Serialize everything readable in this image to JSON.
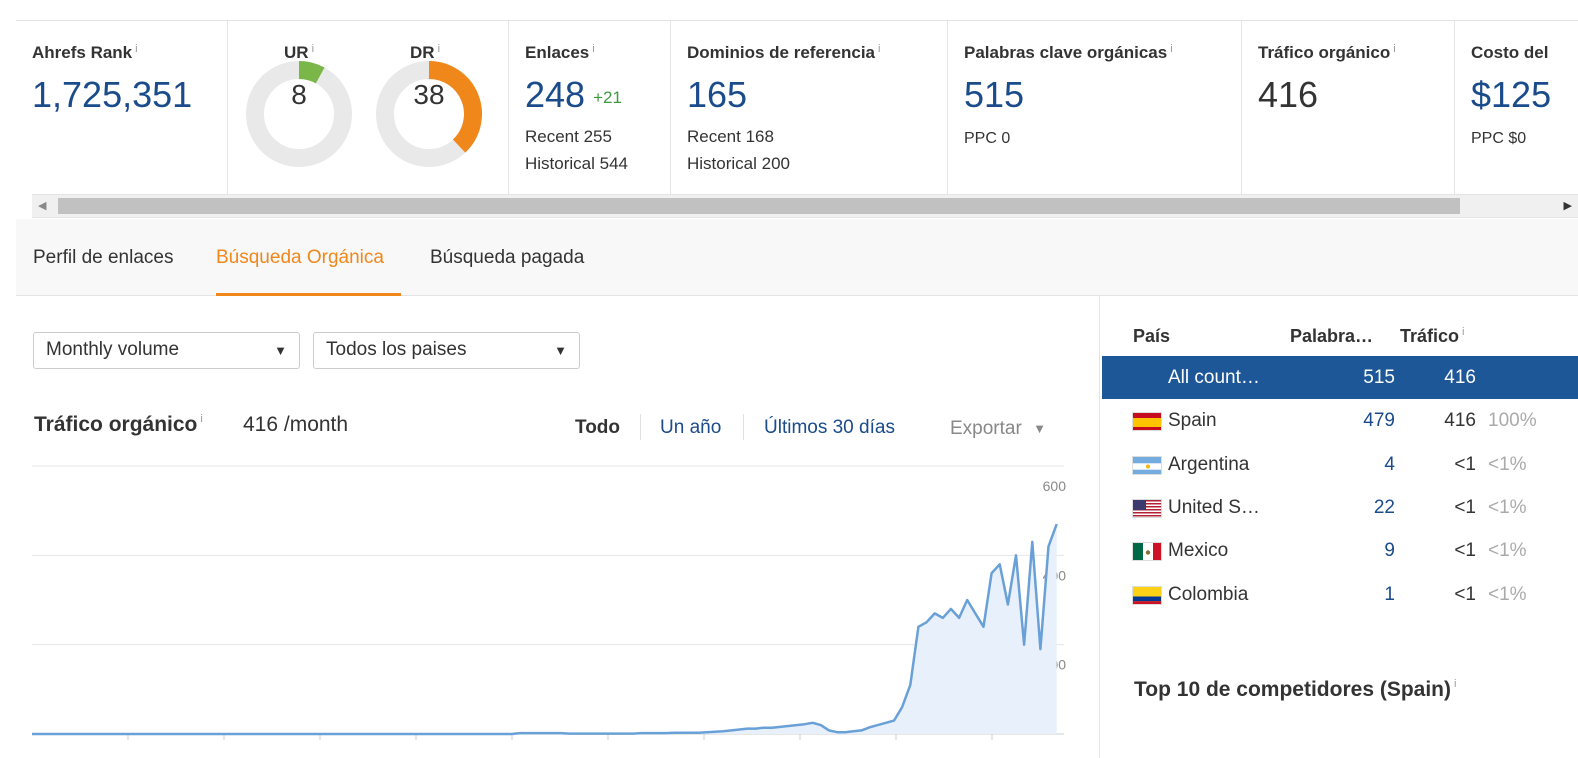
{
  "metrics": {
    "ahrefs_rank": {
      "label": "Ahrefs Rank",
      "value": "1,725,351"
    },
    "ur": {
      "label": "UR",
      "value": "8",
      "level": 8,
      "color": "#7ab648"
    },
    "dr": {
      "label": "DR",
      "value": "38",
      "level": 38,
      "color": "#f0871b"
    },
    "enlaces": {
      "label": "Enlaces",
      "value": "248",
      "delta": "+21",
      "recent": "Recent 255",
      "historical": "Historical 544"
    },
    "dominios": {
      "label": "Dominios de referencia",
      "value": "165",
      "recent": "Recent 168",
      "historical": "Historical 200"
    },
    "palabras": {
      "label": "Palabras clave orgánicas",
      "value": "515",
      "ppc": "PPC 0"
    },
    "trafico": {
      "label": "Tráfico orgánico",
      "value": "416"
    },
    "costo": {
      "label": "Costo del",
      "value": "$125",
      "ppc": "PPC $0"
    },
    "info_glyph": "i"
  },
  "scrollbar": {
    "left_arrow": "◀",
    "right_arrow": "▶"
  },
  "tabs": [
    {
      "label": "Perfil de enlaces",
      "active": false
    },
    {
      "label": "Búsqueda Orgánica",
      "active": true
    },
    {
      "label": "Búsqueda pagada",
      "active": false
    }
  ],
  "filters": {
    "volume": "Monthly volume",
    "country": "Todos los paises",
    "caret": "▼"
  },
  "traffic_panel": {
    "title": "Tráfico orgánico",
    "value": "416 /month",
    "ranges": [
      "Todo",
      "Un año",
      "Últimos 30 días"
    ],
    "selected_range": "Todo",
    "export_label": "Exportar",
    "export_caret": "▼"
  },
  "chart_data": {
    "type": "area",
    "y_ticks": [
      "600",
      "400",
      "200"
    ],
    "ylim": [
      0,
      600
    ],
    "grid": true,
    "series": [
      {
        "color": "#6aa0d8",
        "values": [
          0,
          0,
          0,
          0,
          0,
          0,
          0,
          0,
          0,
          0,
          0,
          0,
          0,
          0,
          0,
          0,
          0,
          0,
          0,
          0,
          0,
          0,
          0,
          0,
          0,
          0,
          0,
          0,
          0,
          0,
          0,
          0,
          0,
          0,
          0,
          0,
          0,
          0,
          0,
          0,
          0,
          0,
          0,
          0,
          0,
          0,
          0,
          0,
          0,
          0,
          0,
          0,
          0,
          0,
          0,
          0,
          0,
          0,
          0,
          0,
          2,
          2,
          2,
          2,
          2,
          2,
          1,
          1,
          1,
          1,
          1,
          1,
          1,
          1,
          1,
          2,
          2,
          2,
          2,
          3,
          3,
          3,
          3,
          4,
          5,
          6,
          8,
          10,
          12,
          12,
          14,
          14,
          16,
          18,
          20,
          22,
          25,
          20,
          8,
          4,
          4,
          6,
          8,
          15,
          20,
          25,
          30,
          60,
          110,
          240,
          250,
          270,
          260,
          280,
          260,
          300,
          270,
          240,
          360,
          380,
          290,
          400,
          200,
          430,
          190,
          420,
          470
        ]
      }
    ],
    "x_range": [
      0,
      121
    ]
  },
  "country_table": {
    "headers": {
      "country": "País",
      "keywords": "Palabra…",
      "traffic": "Tráfico"
    },
    "rows": [
      {
        "country": "All count…",
        "keywords": "515",
        "traffic": "416",
        "pct": "",
        "flag": "none",
        "selected": true
      },
      {
        "country": "Spain",
        "keywords": "479",
        "traffic": "416",
        "pct": "100%",
        "flag": "es",
        "selected": false
      },
      {
        "country": "Argentina",
        "keywords": "4",
        "traffic": "<1",
        "pct": "<1%",
        "flag": "ar",
        "selected": false
      },
      {
        "country": "United S…",
        "keywords": "22",
        "traffic": "<1",
        "pct": "<1%",
        "flag": "us",
        "selected": false
      },
      {
        "country": "Mexico",
        "keywords": "9",
        "traffic": "<1",
        "pct": "<1%",
        "flag": "mx",
        "selected": false
      },
      {
        "country": "Colombia",
        "keywords": "1",
        "traffic": "<1",
        "pct": "<1%",
        "flag": "co",
        "selected": false
      }
    ]
  },
  "competitors": {
    "title": "Top 10 de competidores (Spain)"
  }
}
